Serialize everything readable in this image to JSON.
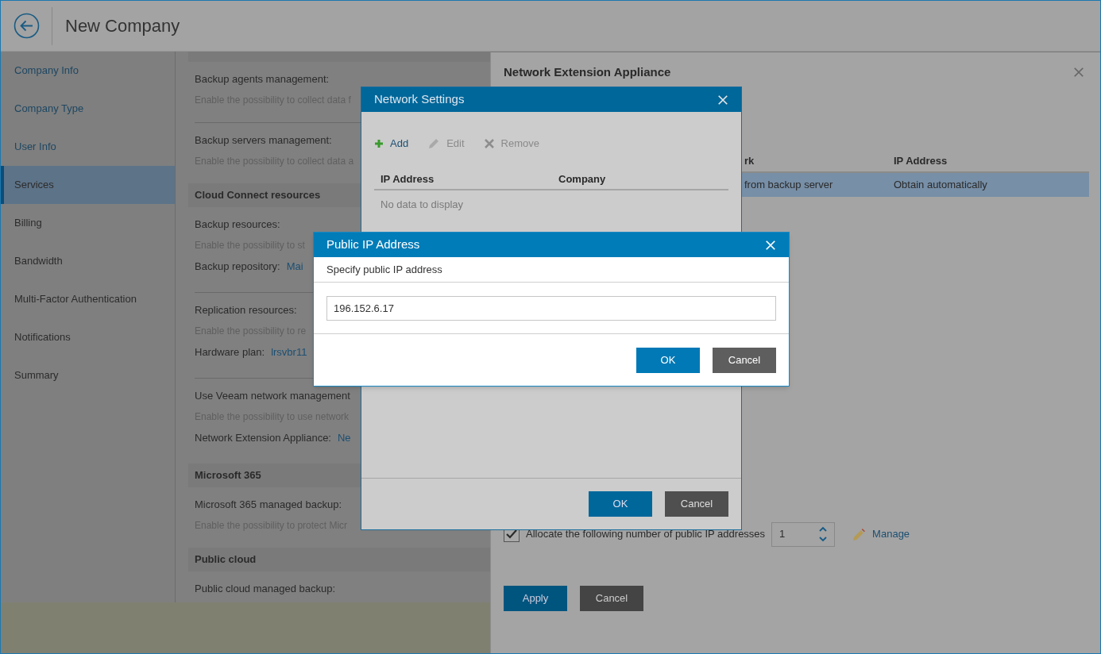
{
  "header": {
    "title": "New Company"
  },
  "sidebar": {
    "items": [
      {
        "label": "Company Info",
        "completed": true,
        "selected": false
      },
      {
        "label": "Company Type",
        "completed": true,
        "selected": false
      },
      {
        "label": "User Info",
        "completed": true,
        "selected": false
      },
      {
        "label": "Services",
        "completed": false,
        "selected": true
      },
      {
        "label": "Billing",
        "completed": false,
        "selected": false
      },
      {
        "label": "Bandwidth",
        "completed": false,
        "selected": false
      },
      {
        "label": "Multi-Factor Authentication",
        "completed": false,
        "selected": false
      },
      {
        "label": "Notifications",
        "completed": false,
        "selected": false
      },
      {
        "label": "Summary",
        "completed": false,
        "selected": false
      }
    ]
  },
  "content": {
    "items": [
      {
        "kind": "band"
      },
      {
        "kind": "setting",
        "label": "Backup agents management:",
        "description": "Enable the possibility to collect data f",
        "divider": true
      },
      {
        "kind": "setting",
        "label": "Backup servers management:",
        "description": "Enable the possibility to collect data a",
        "divider": false
      },
      {
        "kind": "heading",
        "text": "Cloud Connect resources"
      },
      {
        "kind": "setting",
        "label": "Backup resources:",
        "description": "Enable the possibility to st",
        "field": "Backup repository:",
        "value": "Mai",
        "divider": true
      },
      {
        "kind": "setting",
        "label": "Replication resources:",
        "description": "Enable the possibility to re",
        "field": "Hardware plan:",
        "value": "lrsvbr11",
        "divider": true
      },
      {
        "kind": "setting",
        "label": "Use Veeam network management",
        "description": "Enable the possibility to use network",
        "field": "Network Extension Appliance:",
        "value": "Ne",
        "divider": false
      },
      {
        "kind": "heading",
        "text": "Microsoft 365"
      },
      {
        "kind": "setting",
        "label": "Microsoft 365 managed backup:",
        "description": "Enable the possibility to protect Micr",
        "divider": false
      },
      {
        "kind": "heading",
        "text": "Public cloud"
      },
      {
        "kind": "setting",
        "label": "Public cloud managed backup:",
        "divider": false
      }
    ]
  },
  "side_panel": {
    "title": "Network Extension Appliance",
    "table": {
      "columns": [
        "rk",
        "IP Address"
      ],
      "rows": [
        {
          "cells": [
            "from backup server",
            "Obtain automatically"
          ],
          "selected": true
        }
      ]
    },
    "allocate": {
      "label": "Allocate the following number of public IP addresses",
      "checked": true,
      "value": "1"
    },
    "manage_link": "Manage",
    "buttons": [
      {
        "label": "Apply",
        "kind": "primary"
      },
      {
        "label": "Cancel",
        "kind": "secondary"
      }
    ]
  },
  "network_dialog": {
    "title": "Network Settings",
    "toolbar": [
      {
        "label": "Add",
        "kind": "add",
        "disabled": false
      },
      {
        "label": "Edit",
        "kind": "edit",
        "disabled": true
      },
      {
        "label": "Remove",
        "kind": "remove",
        "disabled": true
      }
    ],
    "columns": [
      "IP Address",
      "Company"
    ],
    "empty_text": "No data to display",
    "buttons": [
      {
        "label": "OK",
        "kind": "primary"
      },
      {
        "label": "Cancel",
        "kind": "secondary"
      }
    ]
  },
  "ip_dialog": {
    "title": "Public IP Address",
    "subtitle": "Specify public IP address",
    "value": "196.152.6.17",
    "buttons": [
      {
        "label": "OK",
        "kind": "primary"
      },
      {
        "label": "Cancel",
        "kind": "secondary"
      }
    ]
  }
}
